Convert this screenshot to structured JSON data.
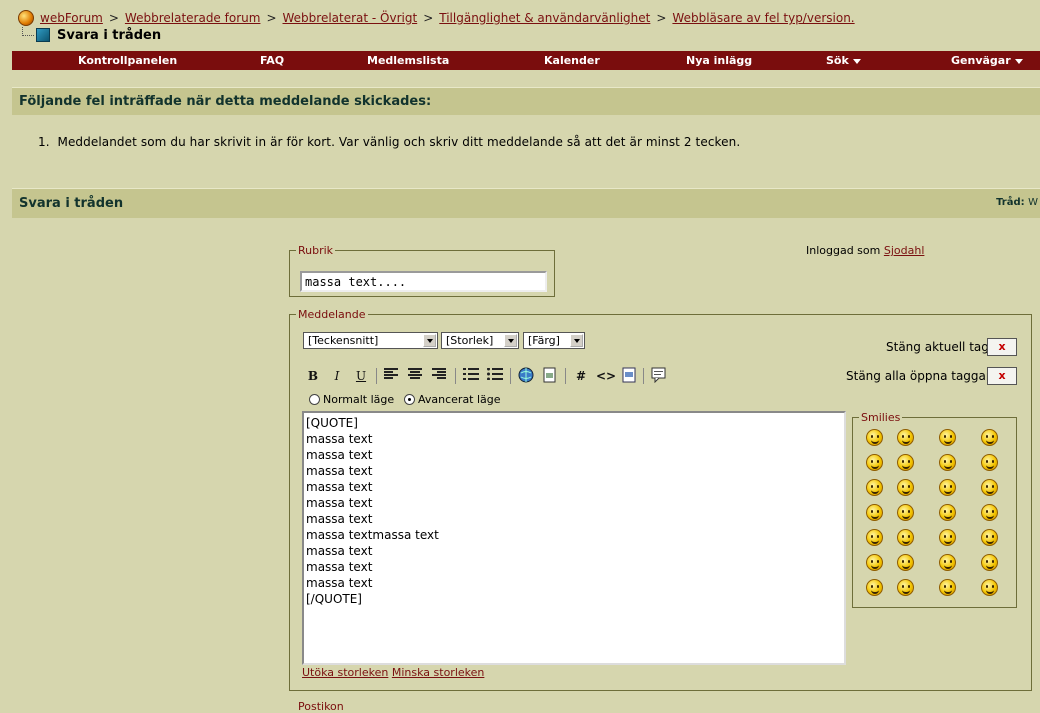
{
  "breadcrumb": {
    "items": [
      "webForum",
      "Webbrelaterade forum",
      "Webbrelaterat - Övrigt",
      "Tillgänglighet & användarvänlighet",
      "Webbläsare av fel typ/version."
    ],
    "separator": ">"
  },
  "thread_title": "Svara i tråden",
  "navbar": {
    "control_panel": "Kontrollpanelen",
    "faq": "FAQ",
    "members": "Medlemslista",
    "calendar": "Kalender",
    "new_posts": "Nya inlägg",
    "search": "Sök",
    "shortcuts": "Genvägar"
  },
  "error": {
    "heading": "Följande fel inträffade när detta meddelande skickades:",
    "items": [
      "Meddelandet som du har skrivit in är för kort. Var vänlig och skriv ditt meddelande så att det är minst 2 tecken."
    ]
  },
  "reply": {
    "heading": "Svara i tråden",
    "thread_label": "Tråd:",
    "thread_value": "W"
  },
  "subject": {
    "legend": "Rubrik",
    "value": "massa text...."
  },
  "logged_in": {
    "label": "Inloggad som",
    "user": "Sjodahl"
  },
  "message": {
    "legend": "Meddelande",
    "font_select": "[Teckensnitt]",
    "size_select": "[Storlek]",
    "color_select": "[Färg]",
    "close_current_label": "Stäng aktuell tag",
    "close_all_label": "Stäng alla öppna taggar",
    "close_symbol": "x",
    "toolbar": {
      "bold": "B",
      "italic": "I",
      "underline": "U",
      "hash": "#",
      "code": "<>"
    },
    "mode_normal": "Normalt läge",
    "mode_advanced": "Avancerat läge",
    "selected_mode": "advanced",
    "content": "[QUOTE]\nmassa text\nmassa text\nmassa text\nmassa text\nmassa text\nmassa text\nmassa textmassa text\nmassa text\nmassa text\nmassa text\n[/QUOTE]",
    "increase_size": "Utöka storleken",
    "decrease_size": "Minska storleken"
  },
  "smilies": {
    "legend": "Smilies",
    "count": 28
  },
  "next_legend": "Postikon"
}
